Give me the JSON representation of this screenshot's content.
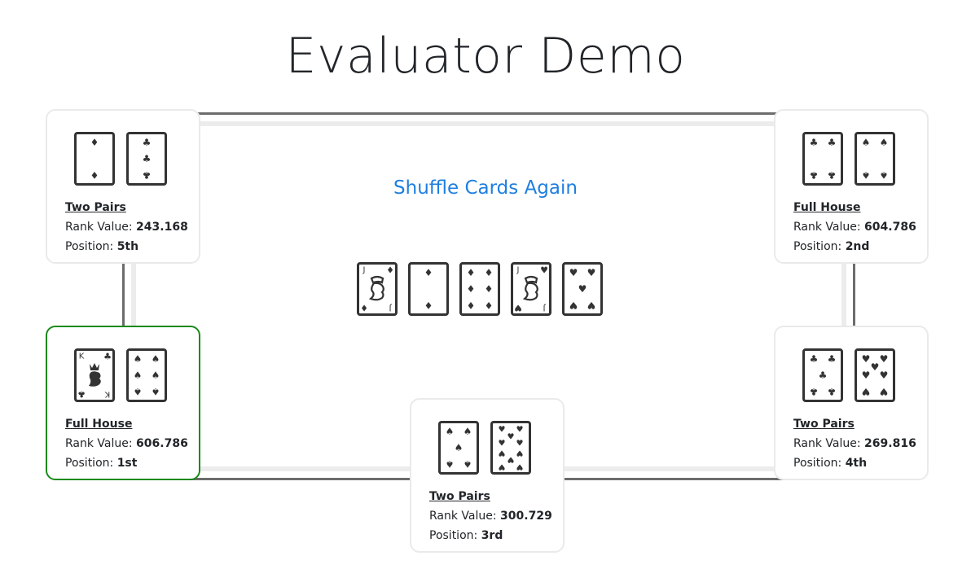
{
  "page": {
    "title": "Evaluator Demo"
  },
  "shuffle_link": "Shuffle Cards Again",
  "labels": {
    "rank_value": "Rank Value: ",
    "position": "Position: "
  },
  "community_cards": [
    {
      "rank": "J",
      "suit": "diamonds"
    },
    {
      "rank": "2",
      "suit": "diamonds"
    },
    {
      "rank": "6",
      "suit": "diamonds"
    },
    {
      "rank": "J",
      "suit": "hearts"
    },
    {
      "rank": "5",
      "suit": "hearts"
    }
  ],
  "players": [
    {
      "hand": "Two Pairs",
      "rank_value": "243.168",
      "position": "5th",
      "cards": [
        {
          "rank": "2",
          "suit": "diamonds"
        },
        {
          "rank": "3",
          "suit": "clubs"
        }
      ]
    },
    {
      "hand": "Full House",
      "rank_value": "604.786",
      "position": "2nd",
      "cards": [
        {
          "rank": "4",
          "suit": "clubs"
        },
        {
          "rank": "4",
          "suit": "spades"
        }
      ]
    },
    {
      "hand": "Full House",
      "rank_value": "606.786",
      "position": "1st",
      "cards": [
        {
          "rank": "K",
          "suit": "clubs"
        },
        {
          "rank": "6",
          "suit": "spades"
        }
      ]
    },
    {
      "hand": "Two Pairs",
      "rank_value": "269.816",
      "position": "4th",
      "cards": [
        {
          "rank": "5",
          "suit": "clubs"
        },
        {
          "rank": "7",
          "suit": "hearts"
        }
      ]
    },
    {
      "hand": "Two Pairs",
      "rank_value": "300.729",
      "position": "3rd",
      "cards": [
        {
          "rank": "5",
          "suit": "spades"
        },
        {
          "rank": "10",
          "suit": "hearts"
        }
      ]
    }
  ],
  "colors": {
    "winner_border": "#1a8a1a",
    "link": "#1f7fe0"
  }
}
